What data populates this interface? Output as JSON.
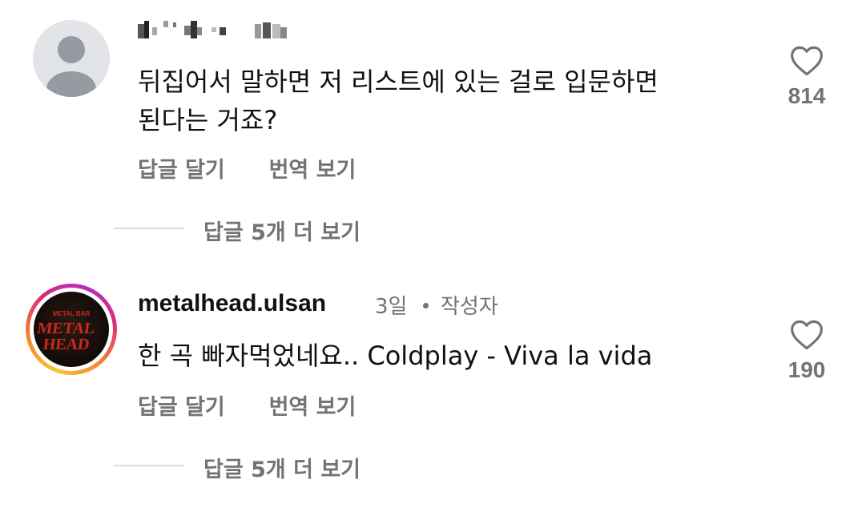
{
  "comments": [
    {
      "username": "",
      "text_line1": "뒤집어서 말하면 저 리스트에 있는 걸로 입문하면",
      "text_line2": "된다는 거죠?",
      "reply_label": "답글 달기",
      "translate_label": "번역 보기",
      "likes": "814",
      "view_replies": "답글 5개 더 보기",
      "avatar": "default-user-icon"
    },
    {
      "username": "metalhead.ulsan",
      "age": "3일",
      "author_badge": "작성자",
      "text": "한 곡 빠자먹었네요.. Coldplay - Viva la vida",
      "reply_label": "답글 달기",
      "translate_label": "번역 보기",
      "likes": "190",
      "view_replies": "답글 5개 더 보기",
      "avatar_logo_top": "METAL BAR",
      "avatar_logo_main": "METAL HEAD",
      "story_ring_colors": [
        "#f9c33a",
        "#f58529",
        "#dd2a7b",
        "#b02fc2"
      ]
    }
  ],
  "colors": {
    "text": "#111111",
    "muted": "#737373",
    "divider": "#dcdcdc",
    "logo_red": "#c8281e"
  },
  "icons": {
    "like": "heart-outline-icon"
  }
}
